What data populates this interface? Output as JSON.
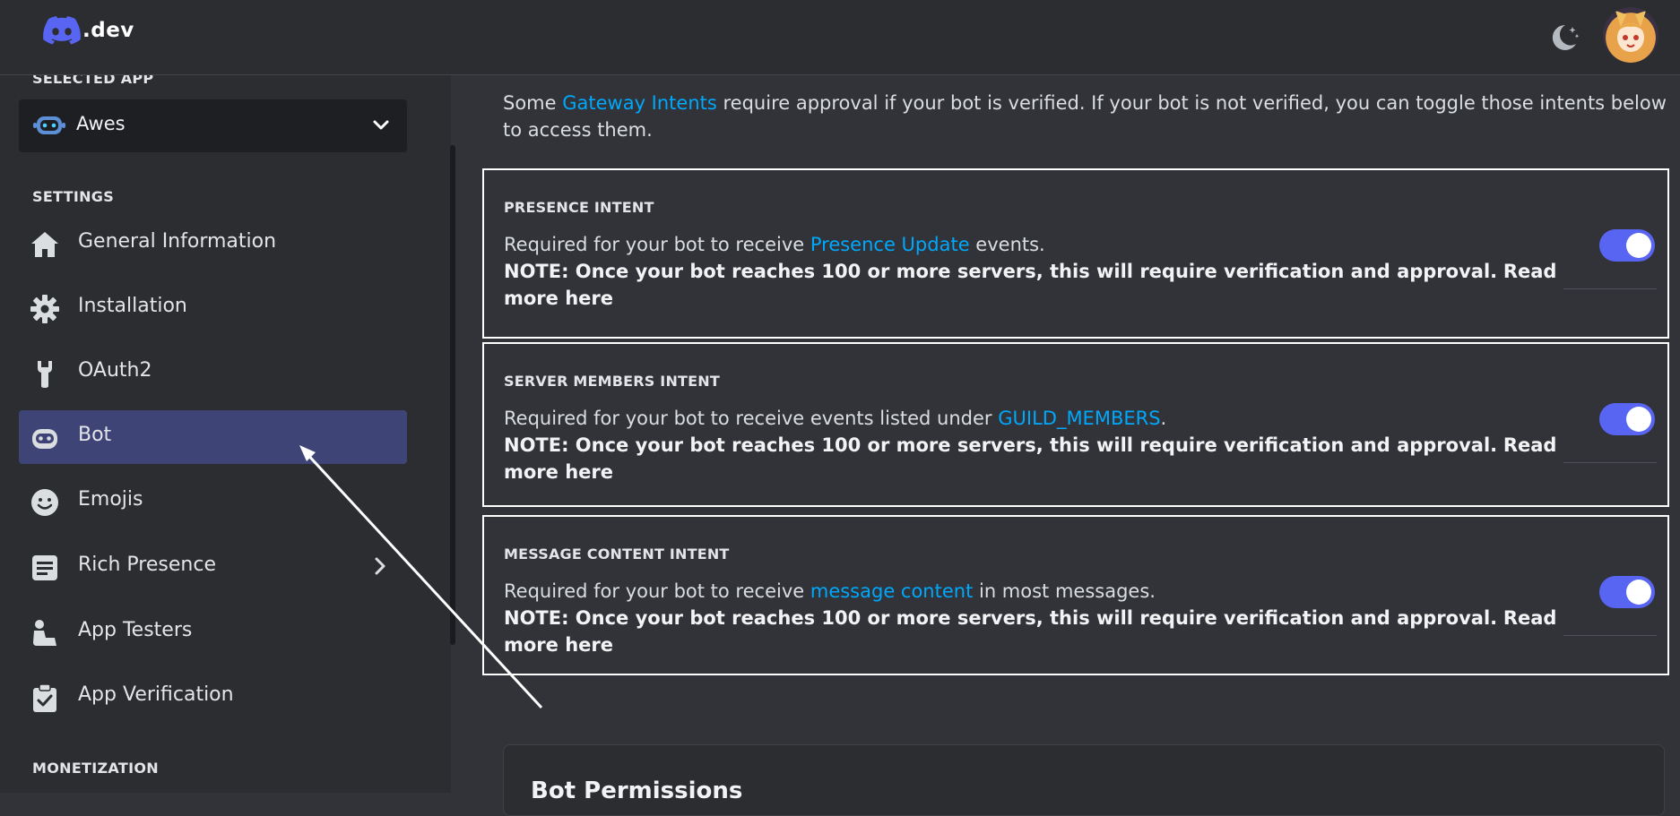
{
  "topbar": {
    "logo_text": ".dev",
    "theme_toggle_icon": "moon-stars-icon",
    "avatar_icon": "user-avatar"
  },
  "sidebar": {
    "selected_app_label": "SELECTED APP",
    "selected_app_name": "Awes",
    "settings_label": "SETTINGS",
    "monetization_label": "MONETIZATION",
    "items": [
      {
        "label": "General Information",
        "icon": "home-icon"
      },
      {
        "label": "Installation",
        "icon": "gear-icon"
      },
      {
        "label": "OAuth2",
        "icon": "wrench-icon"
      },
      {
        "label": "Bot",
        "icon": "bot-icon",
        "active": true
      },
      {
        "label": "Emojis",
        "icon": "smiley-icon"
      },
      {
        "label": "Rich Presence",
        "icon": "document-icon",
        "has_submenu": true
      },
      {
        "label": "App Testers",
        "icon": "tester-icon"
      },
      {
        "label": "App Verification",
        "icon": "clipboard-check-icon"
      }
    ]
  },
  "main": {
    "intro_prefix": "Some ",
    "intro_link": "Gateway Intents",
    "intro_suffix": " require approval if your bot is verified. If your bot is not verified, you can toggle those intents below to access them.",
    "intents": [
      {
        "title": "PRESENCE INTENT",
        "desc_prefix": "Required for your bot to receive ",
        "desc_link": "Presence Update",
        "desc_suffix": " events.",
        "note": "NOTE: Once your bot reaches 100 or more servers, this will require verification and approval.",
        "note_link": "Read more here",
        "enabled": true
      },
      {
        "title": "SERVER MEMBERS INTENT",
        "desc_prefix": "Required for your bot to receive events listed under ",
        "desc_link": "GUILD_MEMBERS",
        "desc_suffix": ".",
        "note": "NOTE: Once your bot reaches 100 or more servers, this will require verification and approval.",
        "note_link": "Read more here",
        "enabled": true
      },
      {
        "title": "MESSAGE CONTENT INTENT",
        "desc_prefix": "Required for your bot to receive ",
        "desc_link": "message content",
        "desc_suffix": " in most messages.",
        "note": "NOTE: Once your bot reaches 100 or more servers, this will require verification and approval.",
        "note_link": "Read more here",
        "enabled": true
      }
    ],
    "permissions_title": "Bot Permissions"
  },
  "colors": {
    "accent": "#5865f2",
    "link": "#00a8fc",
    "active_nav": "#3f4477",
    "background": "#313338",
    "sidebar": "#2b2d31"
  }
}
